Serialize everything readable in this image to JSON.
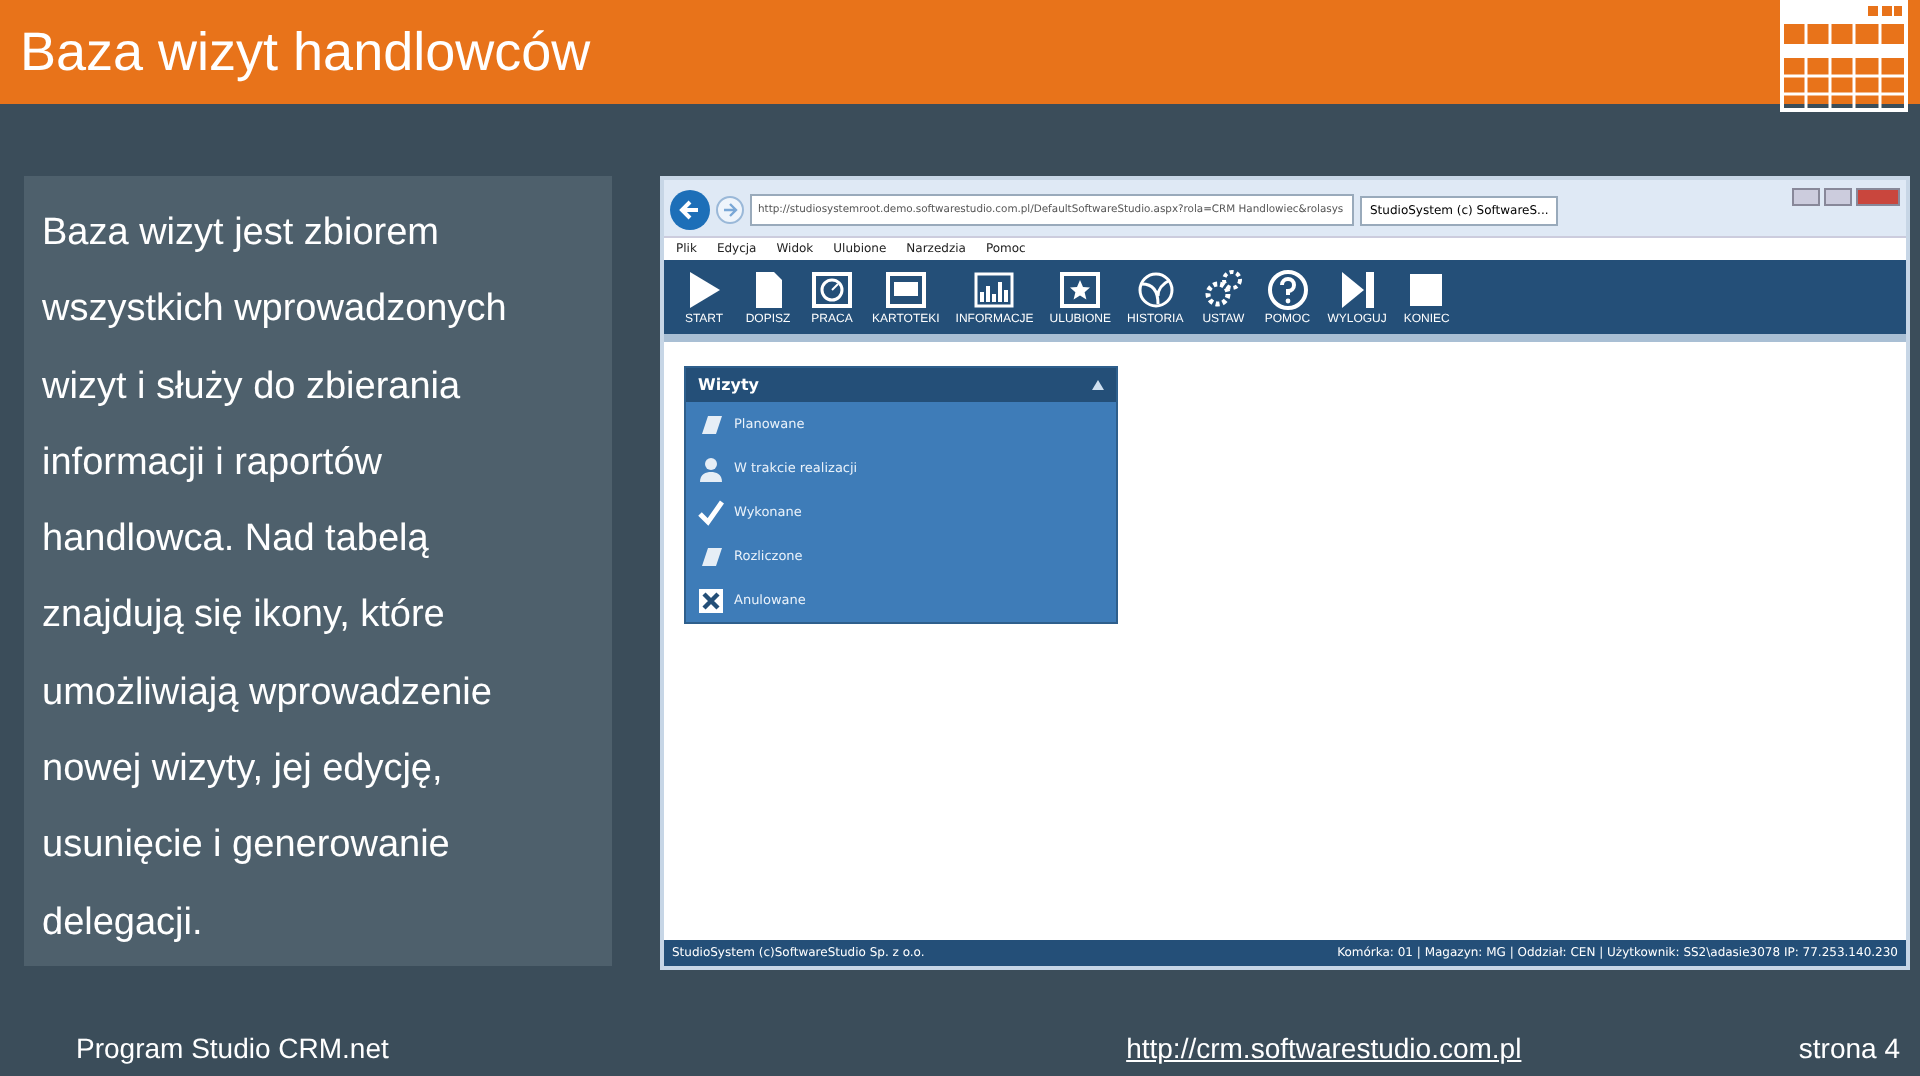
{
  "slide": {
    "title": "Baza wizyt handlowców",
    "description": "Baza wizyt jest zbiorem wszystkich wprowadzonych wizyt i służy do zbierania informacji i raportów handlowca. Nad tabelą znajdują się ikony, które umożliwiają wprowadzenie nowej wizyty, jej edycję, usunięcie i generowanie delegacji."
  },
  "browser": {
    "address": "http://studiosystemroot.demo.softwarestudio.com.pl/DefaultSoftwareStudio.aspx?rola=CRM Handlowiec&rolasys",
    "tab_title": "StudioSystem (c) SoftwareS...",
    "menu": [
      "Plik",
      "Edycja",
      "Widok",
      "Ulubione",
      "Narzedzia",
      "Pomoc"
    ],
    "toolbar": [
      {
        "label": "START",
        "kind": "play"
      },
      {
        "label": "DOPISZ",
        "kind": "document"
      },
      {
        "label": "PRACA",
        "kind": "gauge"
      },
      {
        "label": "KARTOTEKI",
        "kind": "window"
      },
      {
        "label": "INFORMACJE",
        "kind": "chart"
      },
      {
        "label": "ULUBIONE",
        "kind": "star"
      },
      {
        "label": "HISTORIA",
        "kind": "swirl"
      },
      {
        "label": "USTAW",
        "kind": "gear"
      },
      {
        "label": "POMOC",
        "kind": "help"
      },
      {
        "label": "WYLOGUJ",
        "kind": "skip"
      },
      {
        "label": "KONIEC",
        "kind": "stop"
      }
    ],
    "panel": {
      "title": "Wizyty",
      "items": [
        {
          "label": "Planowane",
          "kind": "card"
        },
        {
          "label": "W trakcie realizacji",
          "kind": "person"
        },
        {
          "label": "Wykonane",
          "kind": "check"
        },
        {
          "label": "Rozliczone",
          "kind": "card"
        },
        {
          "label": "Anulowane",
          "kind": "cross"
        }
      ]
    },
    "status_left": "StudioSystem (c)SoftwareStudio Sp. z o.o.",
    "status_right": "Komórka: 01 | Magazyn: MG | Oddział: CEN | Użytkownik: SS2\\adasie3078 IP: 77.253.140.230"
  },
  "footer": {
    "left": "Program Studio CRM.net",
    "link": "http://crm.softwarestudio.com.pl",
    "page": "strona 4"
  }
}
